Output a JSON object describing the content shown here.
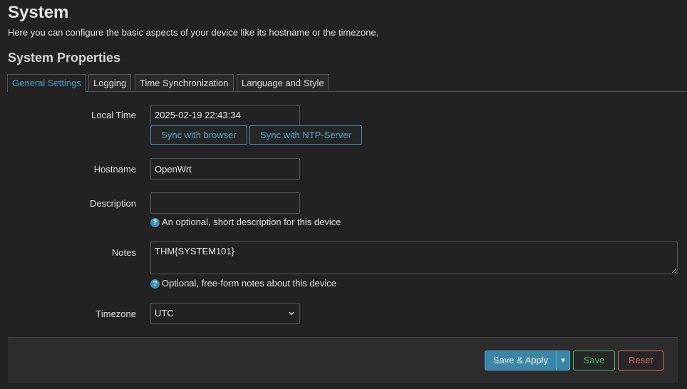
{
  "page": {
    "title": "System",
    "description": "Here you can configure the basic aspects of your device like its hostname or the timezone.",
    "section_title": "System Properties"
  },
  "tabs": [
    {
      "label": "General Settings",
      "active": true
    },
    {
      "label": "Logging",
      "active": false
    },
    {
      "label": "Time Synchronization",
      "active": false
    },
    {
      "label": "Language and Style",
      "active": false
    }
  ],
  "form": {
    "local_time": {
      "label": "Local Time",
      "value": "2025-02-19 22:43:34"
    },
    "sync_browser_label": "Sync with browser",
    "sync_ntp_label": "Sync with NTP-Server",
    "hostname": {
      "label": "Hostname",
      "value": "OpenWrt"
    },
    "description": {
      "label": "Description",
      "value": "",
      "help": "An optional, short description for this device"
    },
    "notes": {
      "label": "Notes",
      "value": "THM{SYSTEM101}",
      "help": "Optional, free-form notes about this device"
    },
    "timezone": {
      "label": "Timezone",
      "value": "UTC"
    },
    "help_glyph": "?"
  },
  "footer": {
    "save_apply_label": "Save & Apply",
    "dropdown_glyph": "▾",
    "save_label": "Save",
    "reset_label": "Reset"
  },
  "colors": {
    "accent": "#4aa0c8",
    "save_green": "#3cb371",
    "reset_red": "#e0645c",
    "background": "#222222"
  }
}
